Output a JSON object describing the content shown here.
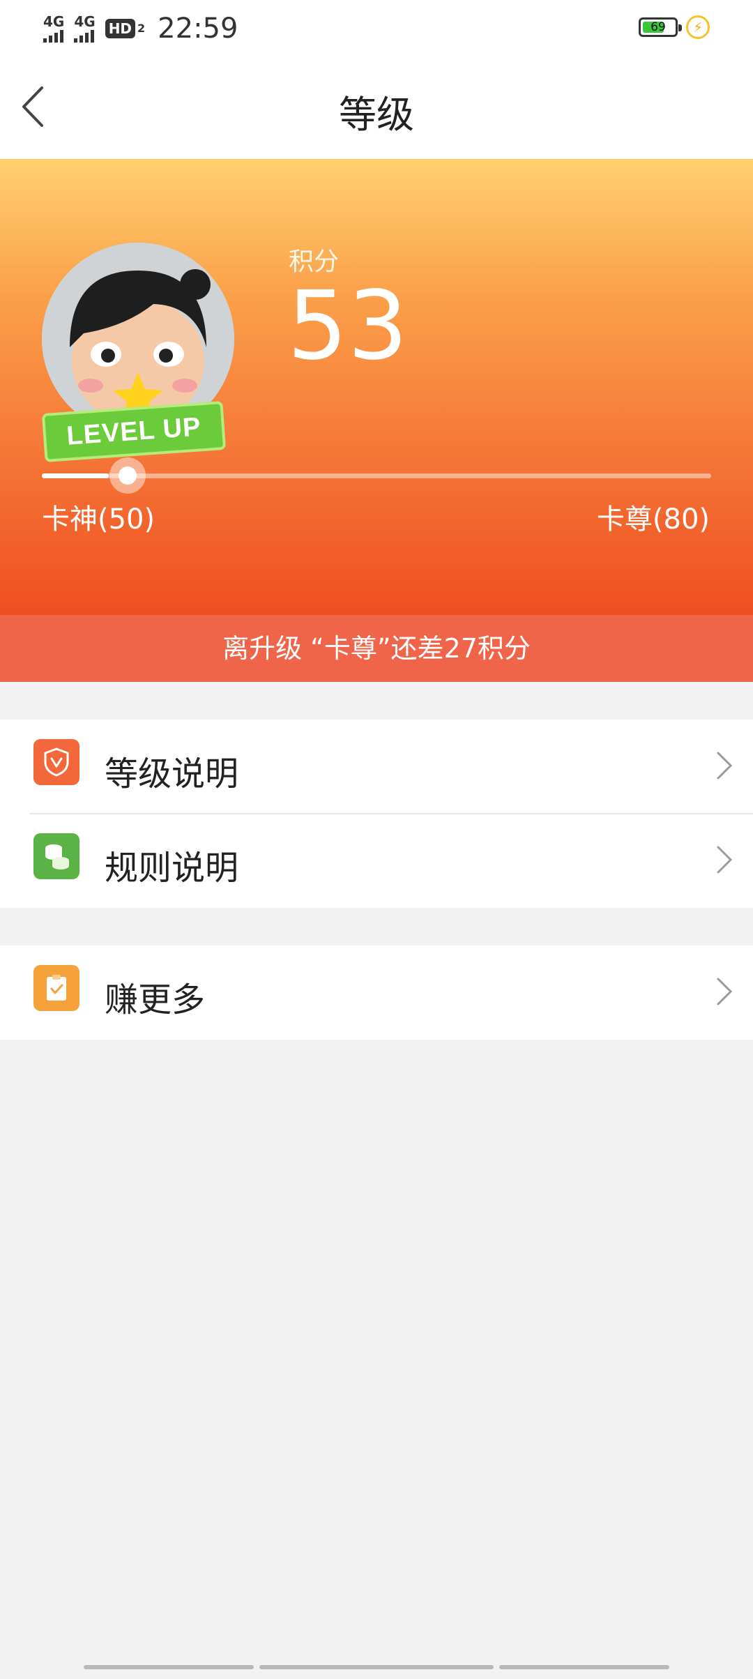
{
  "status_bar": {
    "sim1_network": "4G",
    "sim2_network": "4G",
    "hd_label": "HD",
    "hd_sub": "2",
    "time": "22:59",
    "battery_level": "69",
    "battery_fill_fraction": 0.69,
    "charging_icon": "lightning-bolt-icon"
  },
  "header": {
    "title": "等级",
    "back_icon": "chevron-left-icon"
  },
  "profile": {
    "avatar_badge_text": "LEVEL UP",
    "points_label": "积分",
    "points_value": "53",
    "current_level": "卡神(50)",
    "next_level": "卡尊(80)",
    "progress_fraction": 0.1,
    "notice": "离升级 “卡尊”还差27积分"
  },
  "menu": {
    "group1": [
      {
        "label": "等级说明",
        "icon": "shield-icon",
        "color": "#f2683a"
      },
      {
        "label": "规则说明",
        "icon": "coins-icon",
        "color": "#5ab344"
      }
    ],
    "group2": [
      {
        "label": "赚更多",
        "icon": "clipboard-check-icon",
        "color": "#f6a23a"
      }
    ]
  },
  "colors": {
    "accent": "#ef4e22",
    "notice_bg": "#f0644a",
    "page_bg": "#f2f2f2"
  }
}
